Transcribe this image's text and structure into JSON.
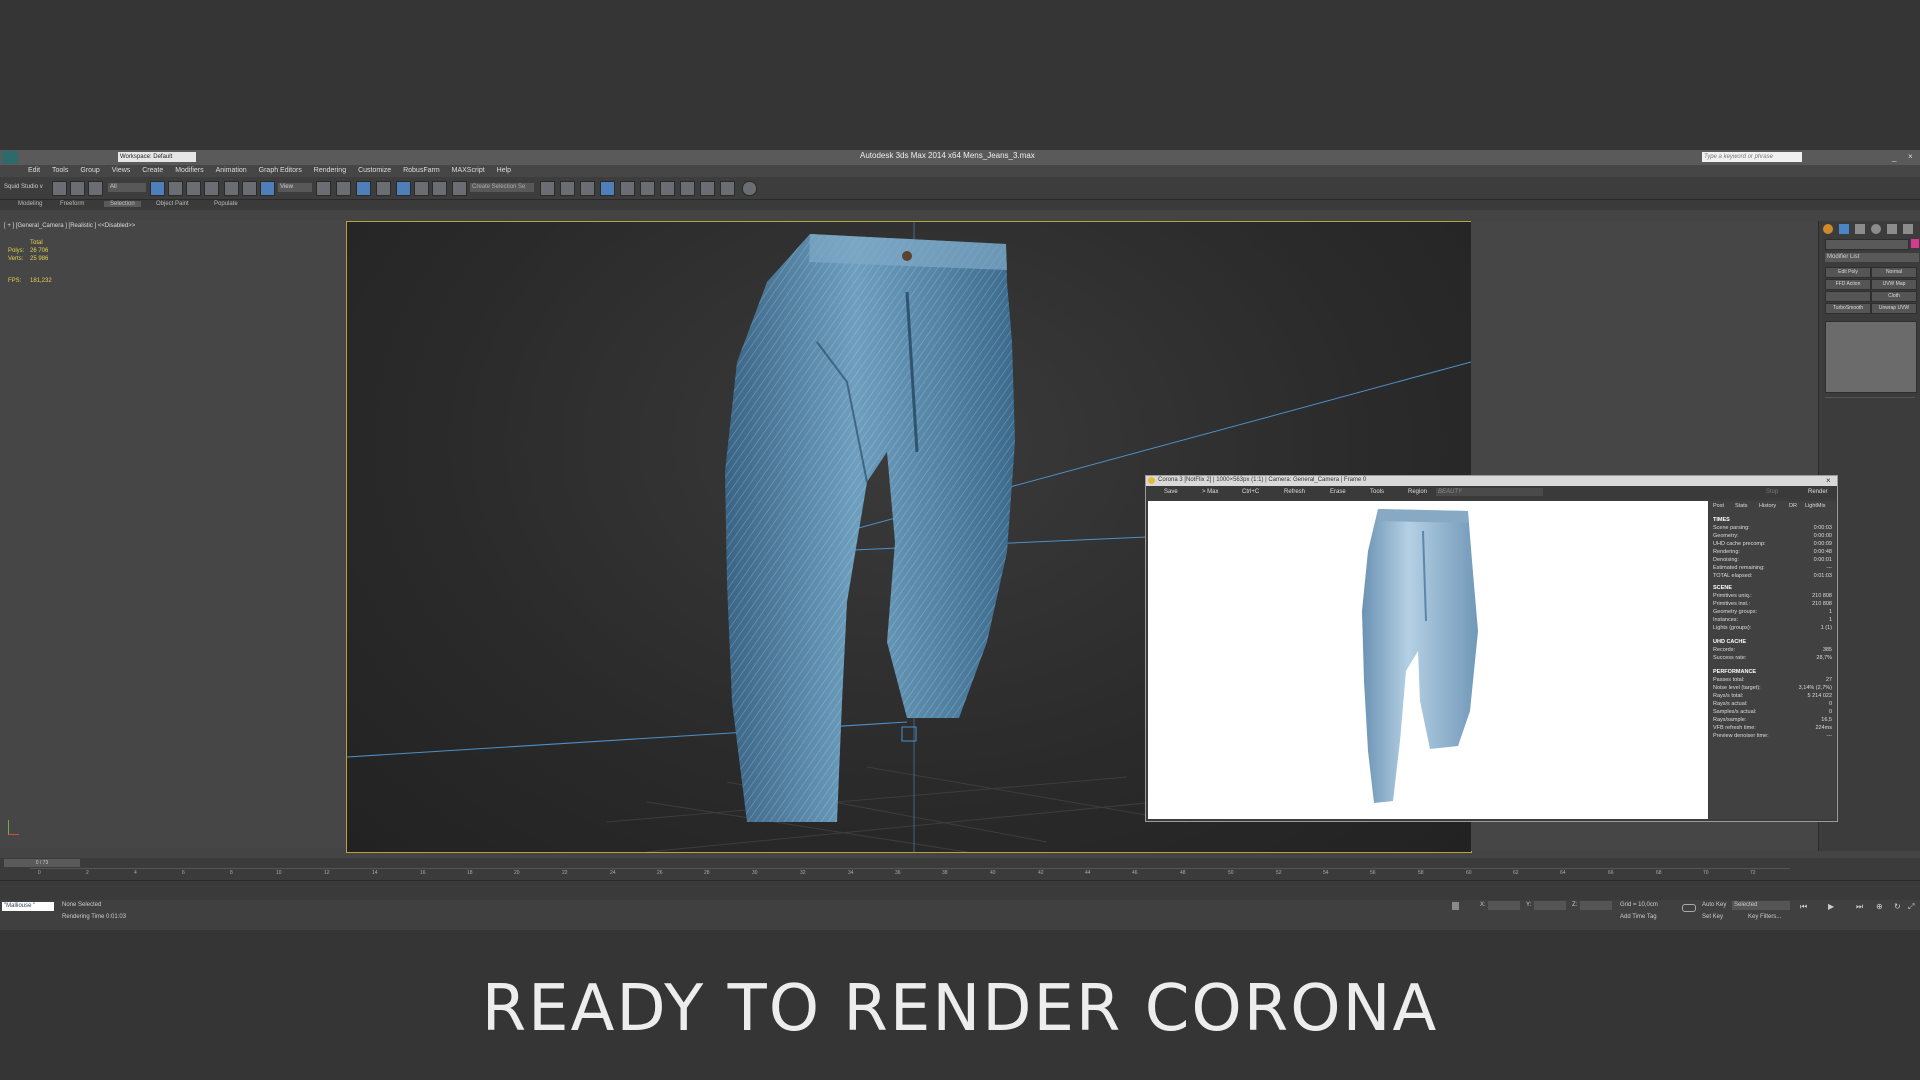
{
  "window": {
    "title": "Autodesk 3ds Max  2014 x64    Mens_Jeans_3.max",
    "workspace": "Workspace: Default",
    "search_placeholder": "Type a keyword or phrase"
  },
  "menu": [
    "Edit",
    "Tools",
    "Group",
    "Views",
    "Create",
    "Modifiers",
    "Animation",
    "Graph Editors",
    "Rendering",
    "Customize",
    "RobusFarm",
    "MAXScript",
    "Help"
  ],
  "toolbar": {
    "studio_label": "Squid Studio v",
    "filter_value": "All",
    "view_value": "View",
    "selection_set_placeholder": "Create Selection Se"
  },
  "ribbon": {
    "tabs": [
      "Modeling",
      "Freeform",
      "Selection",
      "Object Paint",
      "Populate"
    ]
  },
  "viewport": {
    "label": "[ + ] [General_Camera ] [Realistic ]  <<Disabled>>",
    "stats": {
      "total_label": "Total",
      "polys_label": "Polys:",
      "polys_value": "26 706",
      "verts_label": "Verts:",
      "verts_value": "25 986",
      "fps_label": "FPS:",
      "fps_value": "181,232"
    }
  },
  "command_panel": {
    "modifier_list": "Modifier List",
    "buttons": [
      "Edit Poly",
      "Normal",
      "FFD Action",
      "UVW Map",
      "",
      "Cloth",
      "TurboSmooth",
      "Unwrap UVW"
    ]
  },
  "vfb": {
    "title": "Corona 3 [NotFlix 2] | 1000×563px (1:1) | Camera: General_Camera | Frame 0",
    "toolbar": {
      "save": "Save",
      "to_max": "> Max",
      "ctrl_c": "Ctrl+C",
      "refresh": "Refresh",
      "erase": "Erase",
      "tools": "Tools",
      "region": "Region",
      "beauty": "BEAUTY",
      "stop": "Stop",
      "render": "Render"
    },
    "tabs": [
      "Post",
      "Stats",
      "History",
      "DR",
      "LightMix"
    ],
    "sections": {
      "times": {
        "title": "TIMES",
        "rows": [
          [
            "Scene parsing:",
            "0:00:03"
          ],
          [
            "Geometry:",
            "0:00:00"
          ],
          [
            "UHD cache precomp:",
            "0:00:09"
          ],
          [
            "Rendering:",
            "0:00:48"
          ],
          [
            "Denoising:",
            "0:00:01"
          ],
          [
            "Estimated remaining:",
            "---"
          ],
          [
            "TOTAL elapsed:",
            "0:01:03"
          ]
        ]
      },
      "scene": {
        "title": "SCENE",
        "rows": [
          [
            "Primitives uniq.:",
            "210 808"
          ],
          [
            "Primitives inst.:",
            "210 808"
          ],
          [
            "Geometry groups:",
            "1"
          ],
          [
            "Instances:",
            "1"
          ],
          [
            "Lights (groups):",
            "1 (1)"
          ]
        ]
      },
      "uhd": {
        "title": "UHD CACHE",
        "rows": [
          [
            "Records:",
            "385"
          ],
          [
            "Success rate:",
            "28,7%"
          ]
        ]
      },
      "performance": {
        "title": "PERFORMANCE",
        "rows": [
          [
            "Passes total:",
            "27"
          ],
          [
            "Noise level (target):",
            "3,14% (2,7%)"
          ],
          [
            "Rays/s total:",
            "5 214 022"
          ],
          [
            "Rays/s actual:",
            "0"
          ],
          [
            "Samples/s actual:",
            "0"
          ],
          [
            "Rays/sample:",
            "16,5"
          ],
          [
            "VFB refresh time:",
            "224ms"
          ],
          [
            "Preview denoiser time:",
            "---"
          ]
        ]
      }
    }
  },
  "timeline": {
    "frame_label": "0 / 73",
    "ticks": [
      "0",
      "2",
      "4",
      "6",
      "8",
      "10",
      "12",
      "14",
      "16",
      "18",
      "20",
      "22",
      "24",
      "26",
      "28",
      "30",
      "32",
      "34",
      "36",
      "38",
      "40",
      "42",
      "44",
      "46",
      "48",
      "50",
      "52",
      "54",
      "56",
      "58",
      "60",
      "62",
      "64",
      "66",
      "68",
      "70",
      "72"
    ]
  },
  "status": {
    "maxscript_text": "\"Malliouse \"",
    "selection": "None Selected",
    "render_time": "Rendering Time  0:01:03",
    "x_label": "X:",
    "y_label": "Y:",
    "z_label": "Z:",
    "grid": "Grid = 10,0cm",
    "add_time_tag": "Add Time Tag",
    "auto_key": "Auto Key",
    "selected_value": "Selected",
    "set_key": "Set Key",
    "key_filters": "Key Filters..."
  },
  "caption": "READY TO RENDER  CORONA",
  "colors": {
    "viewport_border": "#b8a43d",
    "stat_yellow": "#e4d24e",
    "denim_dark": "#3f6f93",
    "denim_light": "#9cc2dc"
  }
}
